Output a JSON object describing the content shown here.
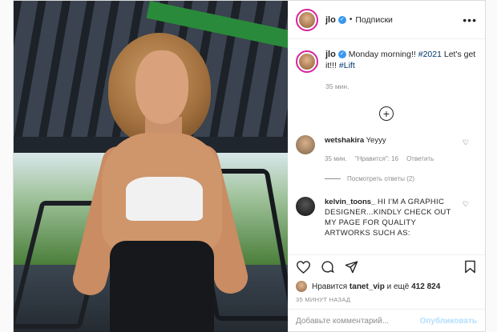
{
  "post": {
    "username": "jlo",
    "separator": "•",
    "follow_label": "Подписки",
    "more_icon": "more-horizontal-icon"
  },
  "caption": {
    "username": "jlo",
    "text_before": "Monday morning!! ",
    "hashtag1": "#2021",
    "text_middle": " Let's get it!!! ",
    "hashtag2": "#Lift",
    "time": "35 мин."
  },
  "comments": [
    {
      "username": "wetshakira",
      "text": "Yeyyy",
      "time": "35 мин.",
      "likes": "\"Нравится\": 16",
      "reply_label": "Ответить",
      "view_replies": "Посмотреть ответы (2)"
    },
    {
      "username": "kelvin_toons_",
      "text": "HI I'M A GRAPHIC DESIGNER...KINDLY CHECK OUT MY PAGE FOR QUALITY ARTWORKS SUCH AS:"
    }
  ],
  "likes": {
    "prefix": "Нравится",
    "user": "tanet_vip",
    "middle": "и ещё",
    "count": "412 824"
  },
  "timestamp": "35 МИНУТ НАЗАД",
  "add_comment": {
    "placeholder": "Добавьте комментарий...",
    "publish_label": "Опубликовать"
  },
  "colors": {
    "verified": "#3897f0",
    "hashtag": "#00376b",
    "publish_disabled": "#b2dffc"
  }
}
